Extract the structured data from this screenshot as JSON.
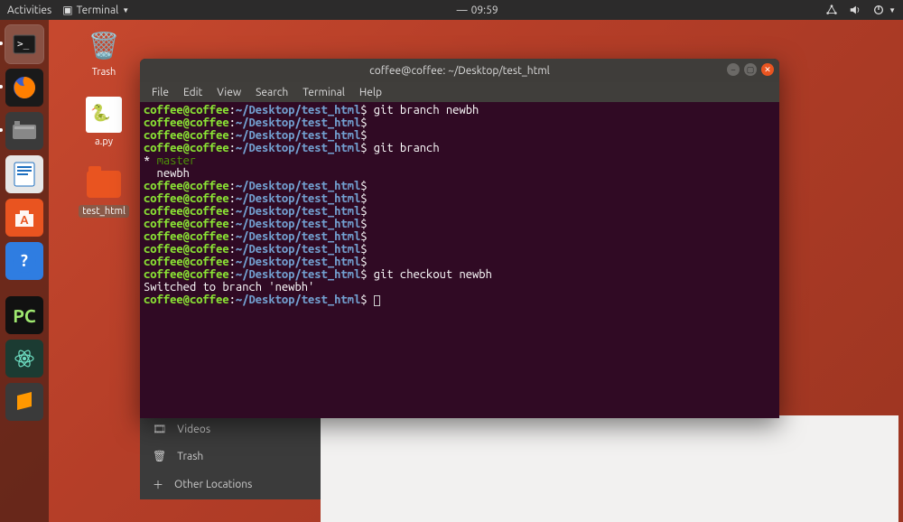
{
  "top_panel": {
    "activities": "Activities",
    "app_menu": "Terminal",
    "clock_glyph": "—",
    "time": "09:59"
  },
  "desktop": {
    "trash": "Trash",
    "apy": "a.py",
    "folder": "test_html"
  },
  "files_sidebar": {
    "videos": "Videos",
    "trash": "Trash",
    "other": "Other Locations"
  },
  "terminal": {
    "title": "coffee@coffee: ~/Desktop/test_html",
    "menus": {
      "file": "File",
      "edit": "Edit",
      "view": "View",
      "search": "Search",
      "terminal": "Terminal",
      "help": "Help"
    },
    "prompt": {
      "userhost": "coffee@coffee",
      "colon": ":",
      "path": "~/Desktop/test_html",
      "sigil": "$"
    },
    "lines": {
      "cmd1": " git branch newbh",
      "cmd2": " git branch",
      "branch_star": "* ",
      "branch_master": "master",
      "branch_newbh": "  newbh",
      "cmd3": " git checkout newbh",
      "switched": "Switched to branch 'newbh'"
    }
  },
  "launcher": {
    "pycharm": "PC"
  }
}
